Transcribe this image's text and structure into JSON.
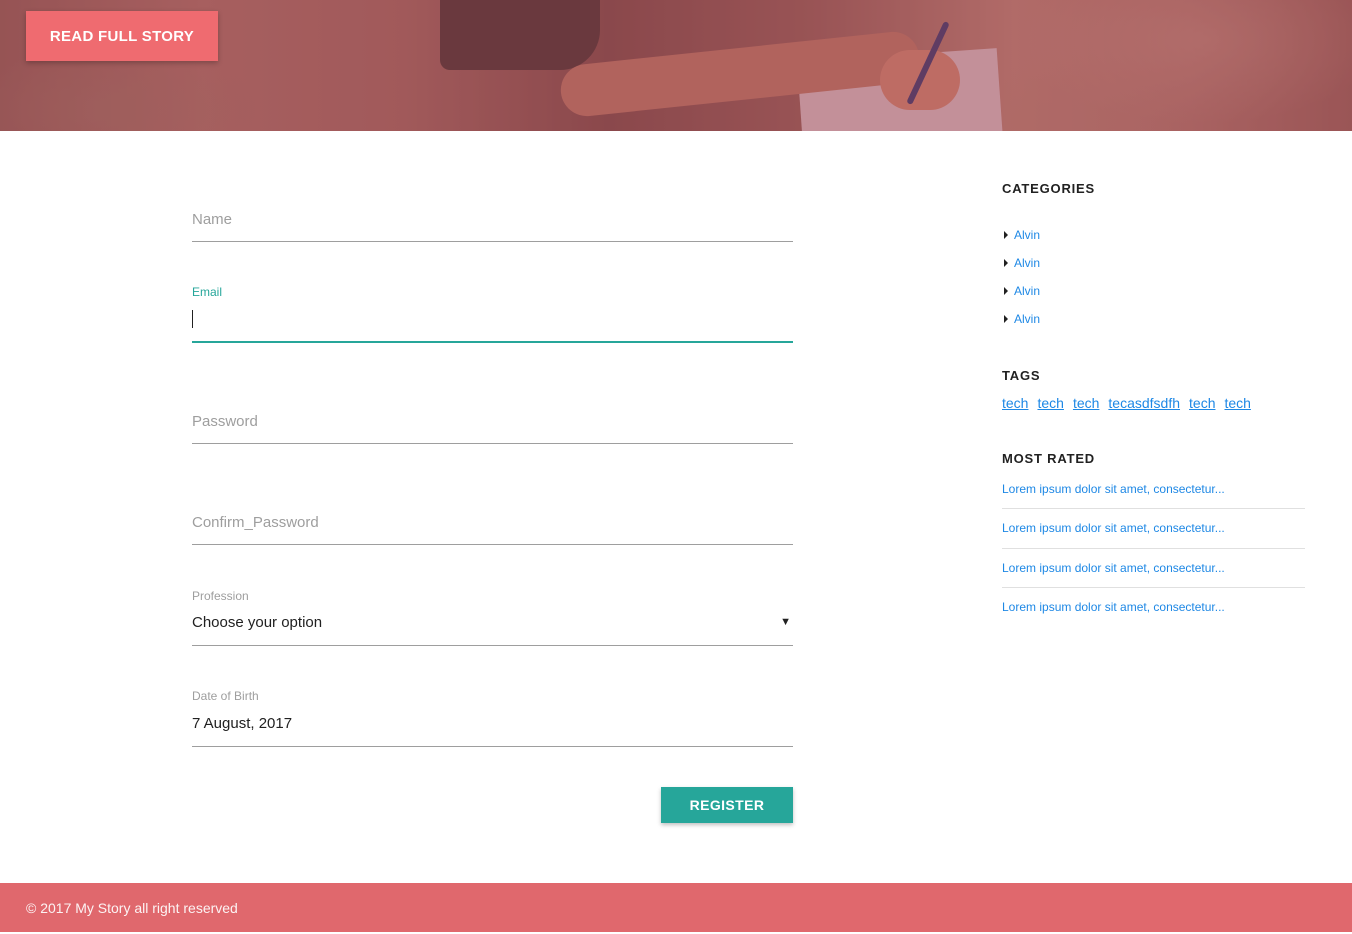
{
  "hero": {
    "button_label": "READ FULL STORY"
  },
  "form": {
    "name": {
      "placeholder": "Name"
    },
    "email": {
      "label": "Email",
      "value": ""
    },
    "password": {
      "placeholder": "Password"
    },
    "confirm_password": {
      "placeholder": "Confirm_Password"
    },
    "profession": {
      "label": "Profession",
      "selected": "Choose your option",
      "arrow": "▼"
    },
    "dob": {
      "label": "Date of Birth",
      "value": "7 August, 2017"
    },
    "register_label": "REGISTER"
  },
  "sidebar": {
    "categories_heading": "CATEGORIES",
    "categories": [
      "Alvin",
      "Alvin",
      "Alvin",
      "Alvin"
    ],
    "tags_heading": "TAGS",
    "tags": [
      "tech",
      "tech",
      "tech",
      "tecasdfsdfh",
      "tech",
      "tech"
    ],
    "most_rated_heading": "MOST RATED",
    "most_rated": [
      "Lorem ipsum dolor sit amet, consectetur...",
      "Lorem ipsum dolor sit amet, consectetur...",
      "Lorem ipsum dolor sit amet, consectetur...",
      "Lorem ipsum dolor sit amet, consectetur..."
    ]
  },
  "footer": {
    "text": "© 2017 My Story all right reserved"
  },
  "colors": {
    "accent": "#26a69a",
    "brand": "#ef6b70",
    "footer": "#e0686d",
    "link": "#1e88e5"
  }
}
